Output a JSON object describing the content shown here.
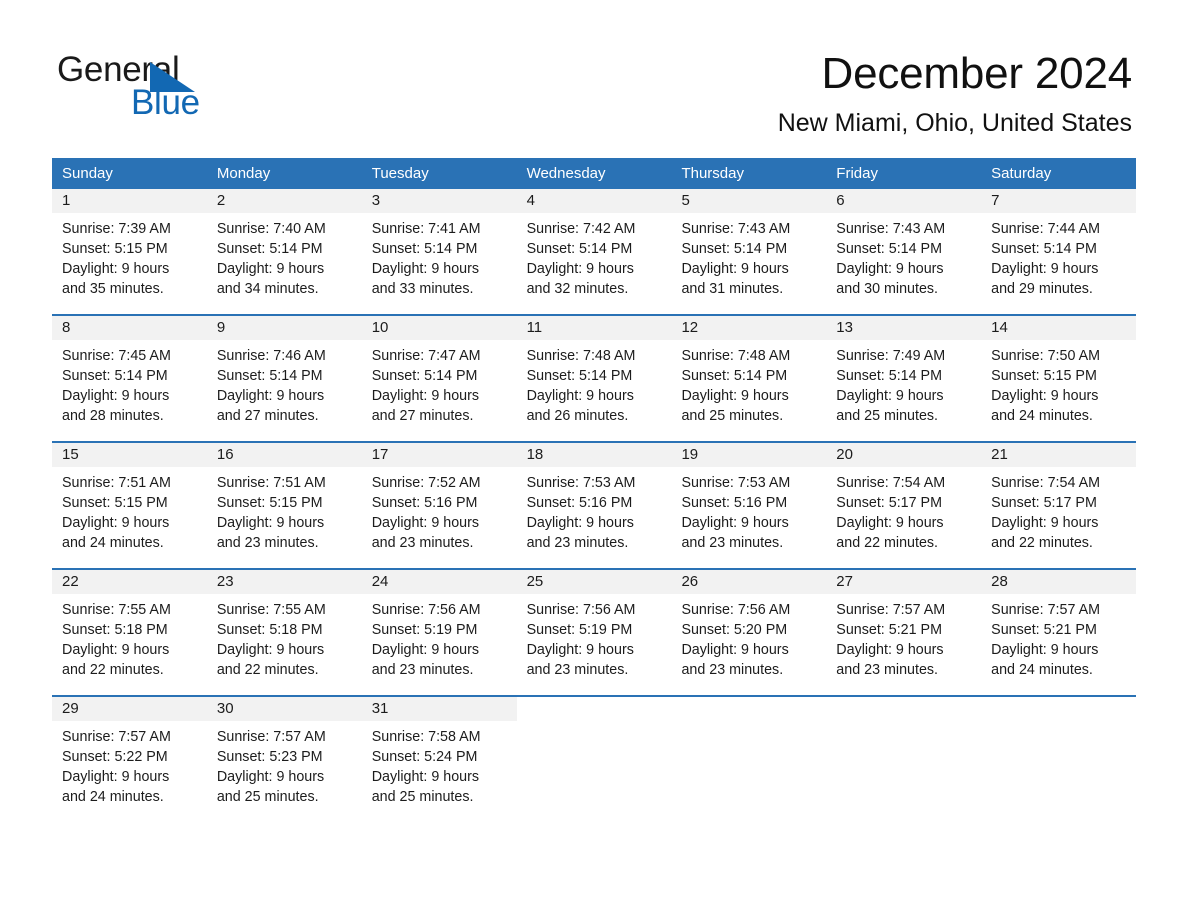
{
  "brand": {
    "name_part1": "General",
    "name_part2": "Blue",
    "triangle_color": "#1268b3",
    "text_color": "#1a1a1a"
  },
  "header": {
    "title": "December 2024",
    "subtitle": "New Miami, Ohio, United States"
  },
  "theme": {
    "header_blue": "#2a72b5",
    "daynum_strip": "#f2f2f2",
    "text": "#1c1c1c"
  },
  "calendar": {
    "day_headers": [
      "Sunday",
      "Monday",
      "Tuesday",
      "Wednesday",
      "Thursday",
      "Friday",
      "Saturday"
    ],
    "weeks": [
      [
        {
          "day": "1",
          "sunrise": "Sunrise: 7:39 AM",
          "sunset": "Sunset: 5:15 PM",
          "daylight1": "Daylight: 9 hours",
          "daylight2": "and 35 minutes."
        },
        {
          "day": "2",
          "sunrise": "Sunrise: 7:40 AM",
          "sunset": "Sunset: 5:14 PM",
          "daylight1": "Daylight: 9 hours",
          "daylight2": "and 34 minutes."
        },
        {
          "day": "3",
          "sunrise": "Sunrise: 7:41 AM",
          "sunset": "Sunset: 5:14 PM",
          "daylight1": "Daylight: 9 hours",
          "daylight2": "and 33 minutes."
        },
        {
          "day": "4",
          "sunrise": "Sunrise: 7:42 AM",
          "sunset": "Sunset: 5:14 PM",
          "daylight1": "Daylight: 9 hours",
          "daylight2": "and 32 minutes."
        },
        {
          "day": "5",
          "sunrise": "Sunrise: 7:43 AM",
          "sunset": "Sunset: 5:14 PM",
          "daylight1": "Daylight: 9 hours",
          "daylight2": "and 31 minutes."
        },
        {
          "day": "6",
          "sunrise": "Sunrise: 7:43 AM",
          "sunset": "Sunset: 5:14 PM",
          "daylight1": "Daylight: 9 hours",
          "daylight2": "and 30 minutes."
        },
        {
          "day": "7",
          "sunrise": "Sunrise: 7:44 AM",
          "sunset": "Sunset: 5:14 PM",
          "daylight1": "Daylight: 9 hours",
          "daylight2": "and 29 minutes."
        }
      ],
      [
        {
          "day": "8",
          "sunrise": "Sunrise: 7:45 AM",
          "sunset": "Sunset: 5:14 PM",
          "daylight1": "Daylight: 9 hours",
          "daylight2": "and 28 minutes."
        },
        {
          "day": "9",
          "sunrise": "Sunrise: 7:46 AM",
          "sunset": "Sunset: 5:14 PM",
          "daylight1": "Daylight: 9 hours",
          "daylight2": "and 27 minutes."
        },
        {
          "day": "10",
          "sunrise": "Sunrise: 7:47 AM",
          "sunset": "Sunset: 5:14 PM",
          "daylight1": "Daylight: 9 hours",
          "daylight2": "and 27 minutes."
        },
        {
          "day": "11",
          "sunrise": "Sunrise: 7:48 AM",
          "sunset": "Sunset: 5:14 PM",
          "daylight1": "Daylight: 9 hours",
          "daylight2": "and 26 minutes."
        },
        {
          "day": "12",
          "sunrise": "Sunrise: 7:48 AM",
          "sunset": "Sunset: 5:14 PM",
          "daylight1": "Daylight: 9 hours",
          "daylight2": "and 25 minutes."
        },
        {
          "day": "13",
          "sunrise": "Sunrise: 7:49 AM",
          "sunset": "Sunset: 5:14 PM",
          "daylight1": "Daylight: 9 hours",
          "daylight2": "and 25 minutes."
        },
        {
          "day": "14",
          "sunrise": "Sunrise: 7:50 AM",
          "sunset": "Sunset: 5:15 PM",
          "daylight1": "Daylight: 9 hours",
          "daylight2": "and 24 minutes."
        }
      ],
      [
        {
          "day": "15",
          "sunrise": "Sunrise: 7:51 AM",
          "sunset": "Sunset: 5:15 PM",
          "daylight1": "Daylight: 9 hours",
          "daylight2": "and 24 minutes."
        },
        {
          "day": "16",
          "sunrise": "Sunrise: 7:51 AM",
          "sunset": "Sunset: 5:15 PM",
          "daylight1": "Daylight: 9 hours",
          "daylight2": "and 23 minutes."
        },
        {
          "day": "17",
          "sunrise": "Sunrise: 7:52 AM",
          "sunset": "Sunset: 5:16 PM",
          "daylight1": "Daylight: 9 hours",
          "daylight2": "and 23 minutes."
        },
        {
          "day": "18",
          "sunrise": "Sunrise: 7:53 AM",
          "sunset": "Sunset: 5:16 PM",
          "daylight1": "Daylight: 9 hours",
          "daylight2": "and 23 minutes."
        },
        {
          "day": "19",
          "sunrise": "Sunrise: 7:53 AM",
          "sunset": "Sunset: 5:16 PM",
          "daylight1": "Daylight: 9 hours",
          "daylight2": "and 23 minutes."
        },
        {
          "day": "20",
          "sunrise": "Sunrise: 7:54 AM",
          "sunset": "Sunset: 5:17 PM",
          "daylight1": "Daylight: 9 hours",
          "daylight2": "and 22 minutes."
        },
        {
          "day": "21",
          "sunrise": "Sunrise: 7:54 AM",
          "sunset": "Sunset: 5:17 PM",
          "daylight1": "Daylight: 9 hours",
          "daylight2": "and 22 minutes."
        }
      ],
      [
        {
          "day": "22",
          "sunrise": "Sunrise: 7:55 AM",
          "sunset": "Sunset: 5:18 PM",
          "daylight1": "Daylight: 9 hours",
          "daylight2": "and 22 minutes."
        },
        {
          "day": "23",
          "sunrise": "Sunrise: 7:55 AM",
          "sunset": "Sunset: 5:18 PM",
          "daylight1": "Daylight: 9 hours",
          "daylight2": "and 22 minutes."
        },
        {
          "day": "24",
          "sunrise": "Sunrise: 7:56 AM",
          "sunset": "Sunset: 5:19 PM",
          "daylight1": "Daylight: 9 hours",
          "daylight2": "and 23 minutes."
        },
        {
          "day": "25",
          "sunrise": "Sunrise: 7:56 AM",
          "sunset": "Sunset: 5:19 PM",
          "daylight1": "Daylight: 9 hours",
          "daylight2": "and 23 minutes."
        },
        {
          "day": "26",
          "sunrise": "Sunrise: 7:56 AM",
          "sunset": "Sunset: 5:20 PM",
          "daylight1": "Daylight: 9 hours",
          "daylight2": "and 23 minutes."
        },
        {
          "day": "27",
          "sunrise": "Sunrise: 7:57 AM",
          "sunset": "Sunset: 5:21 PM",
          "daylight1": "Daylight: 9 hours",
          "daylight2": "and 23 minutes."
        },
        {
          "day": "28",
          "sunrise": "Sunrise: 7:57 AM",
          "sunset": "Sunset: 5:21 PM",
          "daylight1": "Daylight: 9 hours",
          "daylight2": "and 24 minutes."
        }
      ],
      [
        {
          "day": "29",
          "sunrise": "Sunrise: 7:57 AM",
          "sunset": "Sunset: 5:22 PM",
          "daylight1": "Daylight: 9 hours",
          "daylight2": "and 24 minutes."
        },
        {
          "day": "30",
          "sunrise": "Sunrise: 7:57 AM",
          "sunset": "Sunset: 5:23 PM",
          "daylight1": "Daylight: 9 hours",
          "daylight2": "and 25 minutes."
        },
        {
          "day": "31",
          "sunrise": "Sunrise: 7:58 AM",
          "sunset": "Sunset: 5:24 PM",
          "daylight1": "Daylight: 9 hours",
          "daylight2": "and 25 minutes."
        },
        {
          "day": "",
          "sunrise": "",
          "sunset": "",
          "daylight1": "",
          "daylight2": ""
        },
        {
          "day": "",
          "sunrise": "",
          "sunset": "",
          "daylight1": "",
          "daylight2": ""
        },
        {
          "day": "",
          "sunrise": "",
          "sunset": "",
          "daylight1": "",
          "daylight2": ""
        },
        {
          "day": "",
          "sunrise": "",
          "sunset": "",
          "daylight1": "",
          "daylight2": ""
        }
      ]
    ]
  }
}
